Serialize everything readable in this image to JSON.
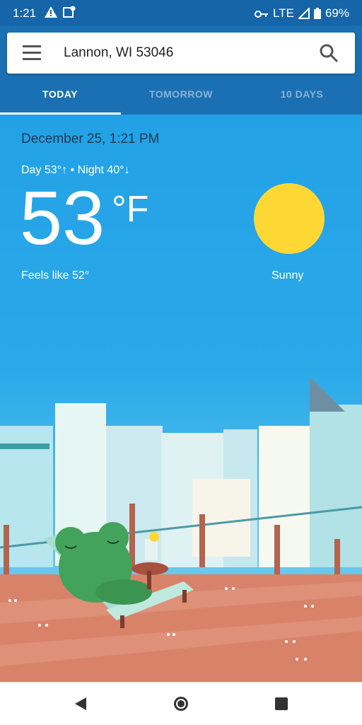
{
  "status_bar": {
    "time": "1:21",
    "network": "LTE",
    "battery": "69%"
  },
  "header": {
    "location": "Lannon, WI 53046",
    "tabs": [
      {
        "label": "TODAY",
        "active": true
      },
      {
        "label": "TOMORROW",
        "active": false
      },
      {
        "label": "10 DAYS",
        "active": false
      }
    ]
  },
  "today": {
    "date": "December 25, 1:21 PM",
    "day_night": "Day 53°↑ • Night 40°↓",
    "temperature": "53",
    "unit": "°F",
    "feels_like": "Feels like 52°",
    "condition": "Sunny"
  },
  "colors": {
    "header": "#1a70b3",
    "status_bar": "#1565a8",
    "sky": "#23a1e6",
    "sun": "#fdd835"
  },
  "icons": [
    "warning-icon",
    "map-icon",
    "key-icon",
    "signal-icon",
    "battery-icon",
    "menu-icon",
    "search-icon",
    "back-icon",
    "home-icon",
    "recents-icon",
    "sun-icon"
  ]
}
